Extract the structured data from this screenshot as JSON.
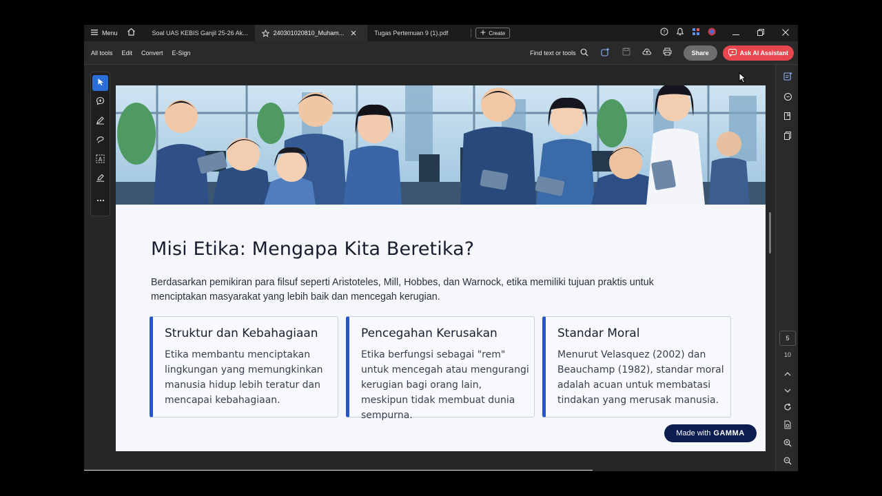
{
  "titlebar": {
    "menu_label": "Menu",
    "tabs": [
      {
        "label": "Soal UAS KEBIS Ganjil 25-26 Ak..."
      },
      {
        "label": "240301020810_Muham..."
      },
      {
        "label": "Tugas Pertemuan 9 (1).pdf"
      }
    ],
    "create_label": "Create"
  },
  "toolbar": {
    "items": [
      "All tools",
      "Edit",
      "Convert",
      "E-Sign"
    ],
    "find_label": "Find text or tools",
    "share_label": "Share",
    "ai_label": "Ask AI Assistant"
  },
  "rightrail": {
    "current_page": "5",
    "total_pages": "10"
  },
  "slide": {
    "title": "Misi Etika: Mengapa Kita Beretika?",
    "intro": "Berdasarkan pemikiran para filsuf seperti Aristoteles, Mill, Hobbes, dan Warnock, etika memiliki tujuan praktis untuk menciptakan masyarakat yang lebih baik dan mencegah kerugian.",
    "cards": [
      {
        "title": "Struktur dan Kebahagiaan",
        "body": "Etika membantu menciptakan lingkungan yang memungkinkan manusia hidup lebih teratur dan mencapai kebahagiaan."
      },
      {
        "title": "Pencegahan Kerusakan",
        "body": "Etika berfungsi sebagai \"rem\" untuk mencegah atau mengurangi kerugian bagi orang lain, meskipun tidak membuat dunia sempurna."
      },
      {
        "title": "Standar Moral",
        "body": "Menurut Velasquez (2002) dan Beauchamp (1982), standar moral adalah acuan untuk membatasi tindakan yang merusak manusia."
      }
    ],
    "badge_prefix": "Made with",
    "badge_brand": "GAMMA"
  },
  "colors": {
    "accent_blue": "#2656c7",
    "ai_button": "#e8474f",
    "badge_bg": "#0c1e4f"
  }
}
